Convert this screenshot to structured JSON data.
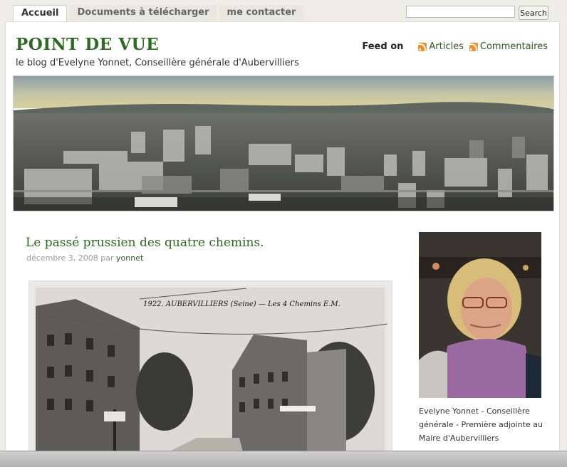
{
  "nav": {
    "tabs": [
      {
        "label": "Accueil"
      },
      {
        "label": "Documents à télécharger"
      },
      {
        "label": "me contacter"
      }
    ],
    "search_button": "Search"
  },
  "header": {
    "title": "POINT DE VUE",
    "description": "le blog d'Evelyne Yonnet, Conseillère générale d'Aubervilliers",
    "feed_on": "Feed on",
    "feeds": [
      {
        "label": "Articles",
        "icon": "rss-icon"
      },
      {
        "label": "Commentaires",
        "icon": "rss-icon"
      }
    ]
  },
  "post": {
    "title": "Le passé prussien des quatre chemins.",
    "date": "décembre 3, 2008",
    "by": "par",
    "author": "yonnet",
    "image_caption": "1922. AUBERVILLIERS (Seine) — Les 4 Chemins E.M."
  },
  "sidebar": {
    "caption": "Evelyne Yonnet - Conseillère générale - Première adjointe au Maire d'Aubervilliers"
  },
  "colors": {
    "title_green": "#2d6a22",
    "link_green": "#2d5a1f",
    "rss_orange": "#f0902a",
    "background": "#efeee6"
  }
}
